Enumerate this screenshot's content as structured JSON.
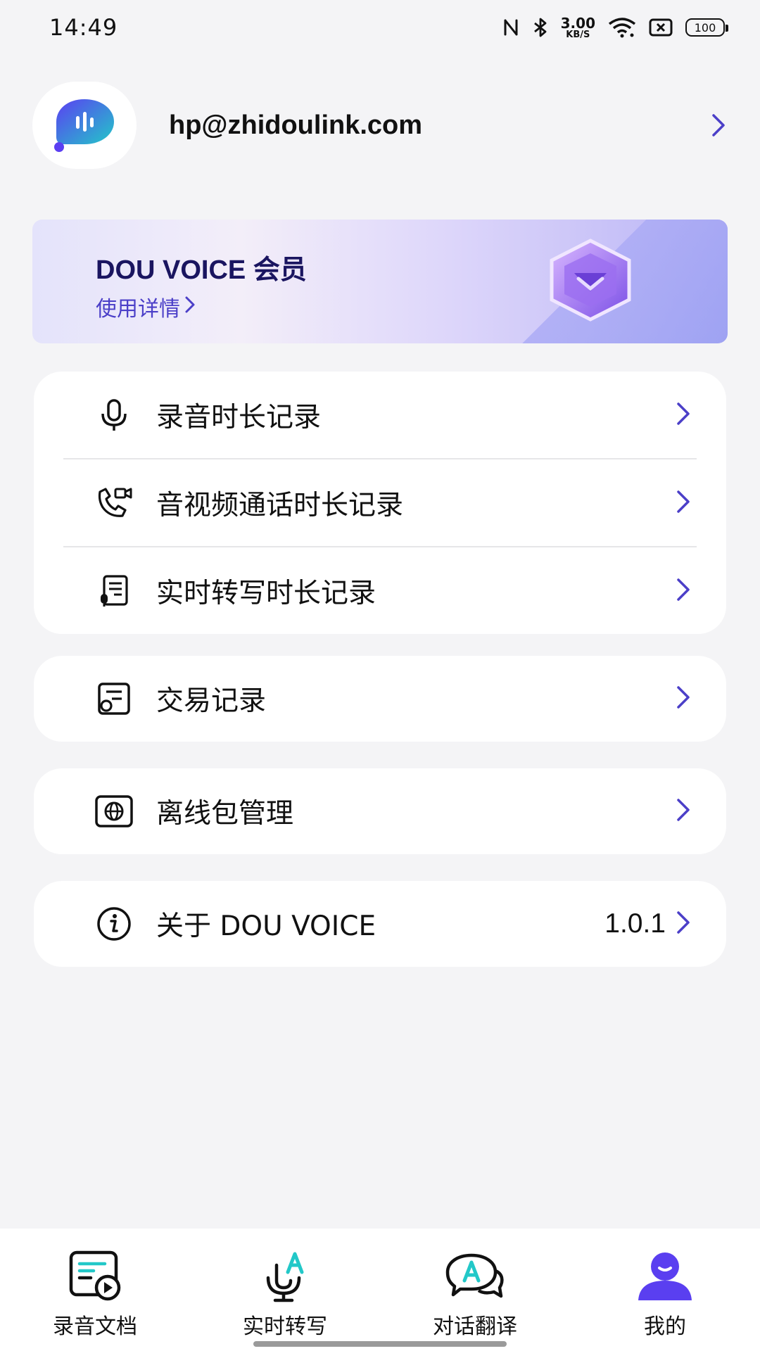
{
  "status_bar": {
    "time": "14:49",
    "speed_value": "3.00",
    "speed_unit": "KB/S",
    "battery": "100",
    "icons": [
      "nfc-icon",
      "bluetooth-icon",
      "wifi-icon",
      "sim-off-icon",
      "battery-icon"
    ]
  },
  "profile": {
    "email": "hp@zhidoulink.com",
    "avatar_icon": "chat-voice-logo-icon"
  },
  "member": {
    "title": "DOU VOICE 会员",
    "link": "使用详情",
    "icon": "diamond-badge-icon"
  },
  "usage_records": [
    {
      "label": "录音时长记录",
      "icon": "microphone-icon"
    },
    {
      "label": "音视频通话时长记录",
      "icon": "video-call-icon"
    },
    {
      "label": "实时转写时长记录",
      "icon": "transcribe-doc-icon"
    }
  ],
  "transactions": {
    "label": "交易记录",
    "icon": "receipt-icon"
  },
  "offline": {
    "label": "离线包管理",
    "icon": "globe-package-icon"
  },
  "about": {
    "label": "关于 DOU VOICE",
    "value": "1.0.1",
    "icon": "info-icon"
  },
  "bottom_nav": [
    {
      "label": "录音文档",
      "icon": "record-doc-icon"
    },
    {
      "label": "实时转写",
      "icon": "live-transcribe-icon"
    },
    {
      "label": "对话翻译",
      "icon": "conversation-translate-icon"
    },
    {
      "label": "我的",
      "icon": "profile-icon",
      "active": true
    }
  ],
  "colors": {
    "accent": "#4b3fc8",
    "active_nav": "#5a3ff0",
    "teal": "#22c8c8"
  }
}
